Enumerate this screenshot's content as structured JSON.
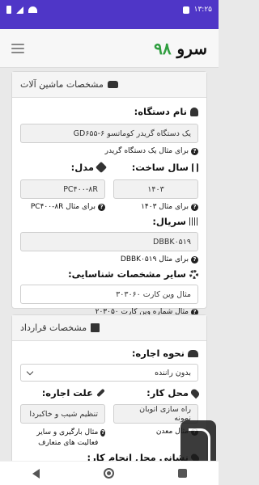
{
  "status_bar": {
    "time": "۱۳:۲۵"
  },
  "header": {
    "logo_word": "سرو",
    "logo_number": "۹۸"
  },
  "machine_card": {
    "title": "مشخصات ماشین آلات",
    "device_name": {
      "label": "نام دستگاه:",
      "value": "یک دستگاه گریدر کوماتسو GD۶۵۵-۶",
      "hint": "برای مثال یک دستگاه گریدر"
    },
    "year": {
      "label": "سال ساخت:",
      "value": "۱۴۰۳",
      "hint": "برای مثال ۱۴۰۳"
    },
    "model": {
      "label": "مدل:",
      "value": "PC۴۰۰-۸R",
      "hint": "برای مثال PC۴۰۰-۸R"
    },
    "serial": {
      "label": "سریال:",
      "value": "DBBK۰۵۱۹",
      "hint": "برای مثال DBBK۰۵۱۹"
    },
    "other_ids": {
      "label": "سایر مشخصات شناسایی:",
      "value": "مثال وین کارت ۳۰۳۰۶۰",
      "hint": "مثال شماره وین کارت ۲۰۳۰۵۰"
    }
  },
  "contract_card": {
    "title": "مشخصات قرارداد",
    "rental_type": {
      "label": "نحوه اجاره:",
      "selected": "بدون راننده"
    },
    "work_location": {
      "label": "محل کار:",
      "value": "راه سازی اتوبان نمونه",
      "hint": "مثال معدن"
    },
    "rental_reason": {
      "label": "علت اجاره:",
      "value": "تنظیم شیب و خاکبردا",
      "hint": "مثال بارگیری و سایر فعالیت های متعارف"
    },
    "work_address": {
      "label": "نشانی محل انجام کار:"
    }
  }
}
